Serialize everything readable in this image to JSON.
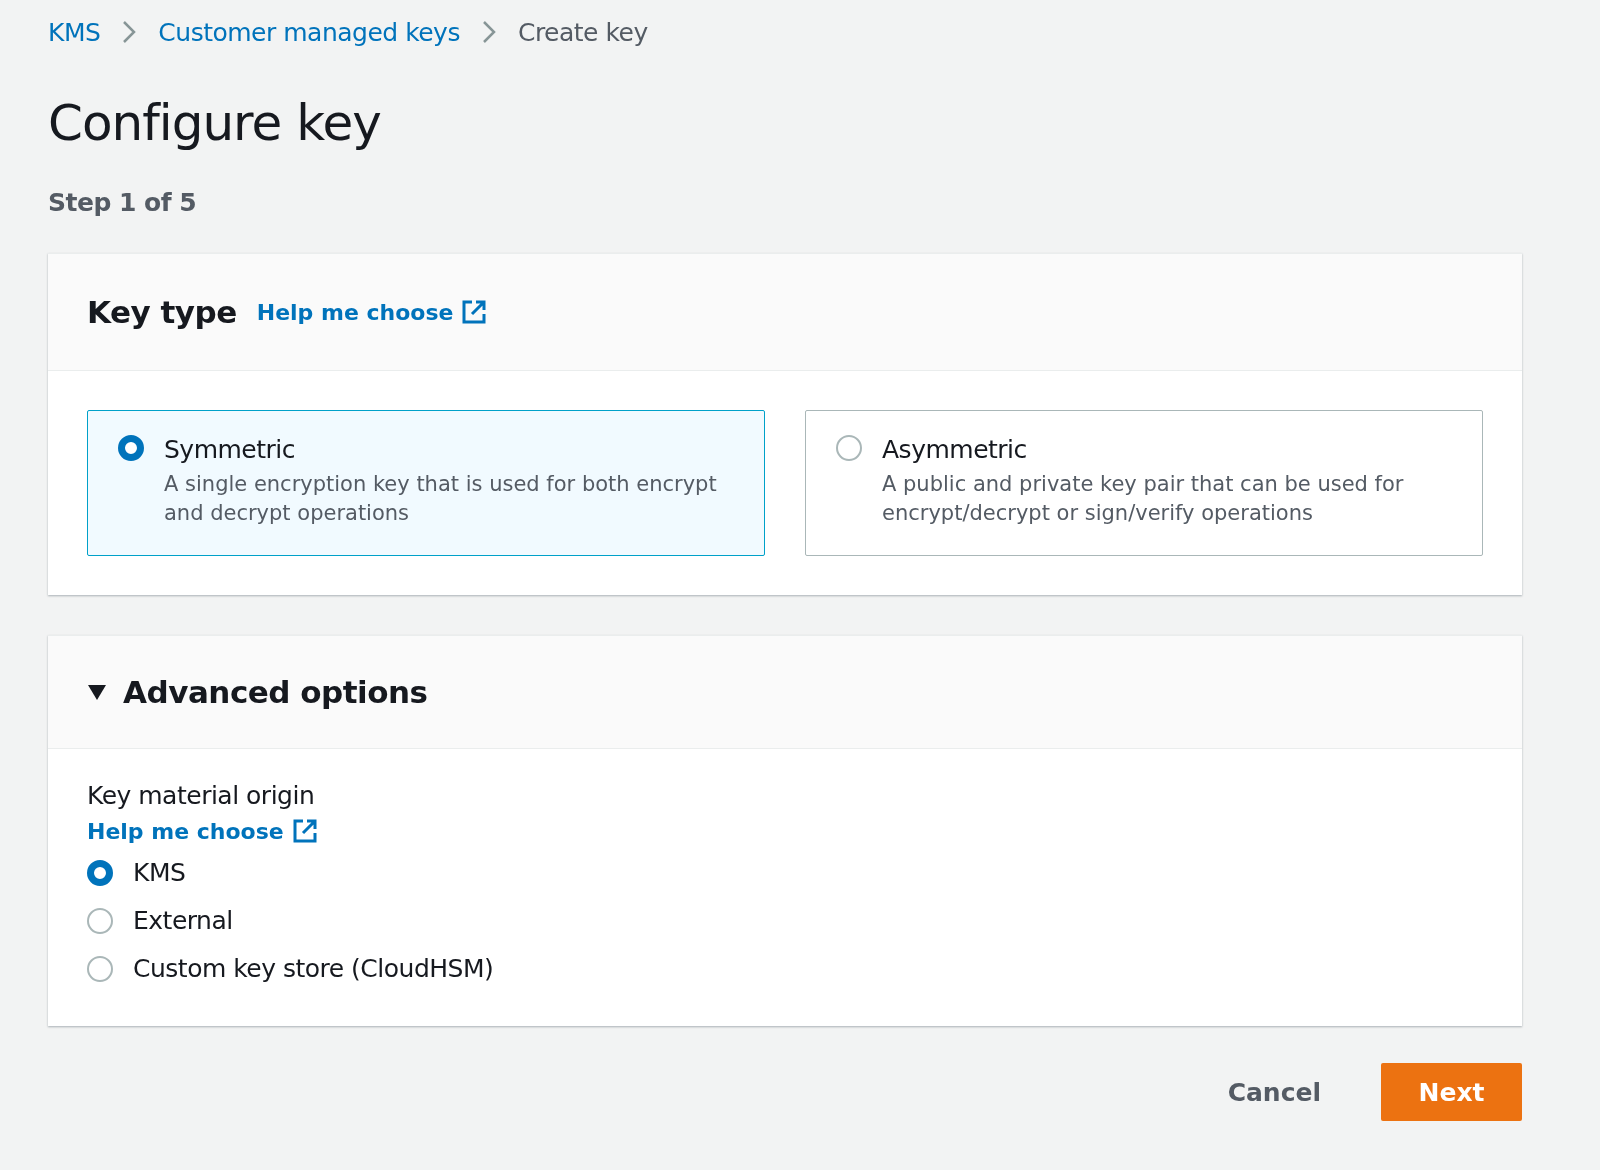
{
  "breadcrumbs": [
    {
      "label": "KMS",
      "kind": "link"
    },
    {
      "label": "Customer managed keys",
      "kind": "link"
    },
    {
      "label": "Create key",
      "kind": "current"
    }
  ],
  "title": "Configure key",
  "step": "Step 1 of 5",
  "key_type": {
    "title": "Key type",
    "help_link": "Help me choose",
    "options": [
      {
        "label": "Symmetric",
        "description": "A single encryption key that is used for both encrypt and decrypt operations",
        "selected": true
      },
      {
        "label": "Asymmetric",
        "description": "A public and private key pair that can be used for encrypt/decrypt or sign/verify operations",
        "selected": false
      }
    ]
  },
  "advanced": {
    "title": "Advanced options",
    "expanded": true,
    "origin_label": "Key material origin",
    "help_link": "Help me choose",
    "options": [
      {
        "label": "KMS",
        "selected": true
      },
      {
        "label": "External",
        "selected": false
      },
      {
        "label": "Custom key store (CloudHSM)",
        "selected": false
      }
    ]
  },
  "actions": {
    "cancel": "Cancel",
    "next": "Next"
  }
}
